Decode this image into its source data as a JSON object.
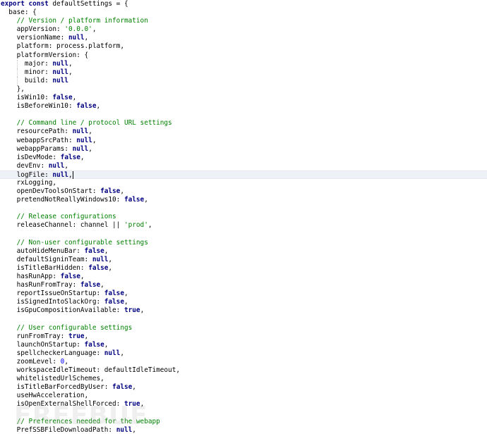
{
  "code_lines": [
    [
      {
        "t": "export const ",
        "k": "kw"
      },
      {
        "t": "defaultSettings = {",
        "k": "plain"
      }
    ],
    [
      {
        "t": "  base: {",
        "k": "plain"
      }
    ],
    [
      {
        "t": "    // Version / platform information",
        "k": "comment"
      }
    ],
    [
      {
        "t": "    appVersion: ",
        "k": "plain"
      },
      {
        "t": "'0.0.0'",
        "k": "str"
      },
      {
        "t": ",",
        "k": "plain"
      }
    ],
    [
      {
        "t": "    versionName: ",
        "k": "plain"
      },
      {
        "t": "null",
        "k": "null"
      },
      {
        "t": ",",
        "k": "plain"
      }
    ],
    [
      {
        "t": "    platform: process.platform,",
        "k": "plain"
      }
    ],
    [
      {
        "t": "    platformVersion: {",
        "k": "plain"
      }
    ],
    [
      {
        "t": "      major: ",
        "k": "plain"
      },
      {
        "t": "null",
        "k": "null"
      },
      {
        "t": ",",
        "k": "plain"
      }
    ],
    [
      {
        "t": "      minor: ",
        "k": "plain"
      },
      {
        "t": "null",
        "k": "null"
      },
      {
        "t": ",",
        "k": "plain"
      }
    ],
    [
      {
        "t": "      build: ",
        "k": "plain"
      },
      {
        "t": "null",
        "k": "null"
      }
    ],
    [
      {
        "t": "    },",
        "k": "plain"
      }
    ],
    [
      {
        "t": "    isWin10: ",
        "k": "plain"
      },
      {
        "t": "false",
        "k": "bool"
      },
      {
        "t": ",",
        "k": "plain"
      }
    ],
    [
      {
        "t": "    isBeforeWin10: ",
        "k": "plain"
      },
      {
        "t": "false",
        "k": "bool"
      },
      {
        "t": ",",
        "k": "plain"
      }
    ],
    [],
    [
      {
        "t": "    // Command line / protocol URL settings",
        "k": "comment"
      }
    ],
    [
      {
        "t": "    resourcePath: ",
        "k": "plain"
      },
      {
        "t": "null",
        "k": "null"
      },
      {
        "t": ",",
        "k": "plain"
      }
    ],
    [
      {
        "t": "    webappSrcPath: ",
        "k": "plain"
      },
      {
        "t": "null",
        "k": "null"
      },
      {
        "t": ",",
        "k": "plain"
      }
    ],
    [
      {
        "t": "    webappParams: ",
        "k": "plain"
      },
      {
        "t": "null",
        "k": "null"
      },
      {
        "t": ",",
        "k": "plain"
      }
    ],
    [
      {
        "t": "    isDevMode: ",
        "k": "plain"
      },
      {
        "t": "false",
        "k": "bool"
      },
      {
        "t": ",",
        "k": "plain"
      }
    ],
    [
      {
        "t": "    devEnv: ",
        "k": "plain"
      },
      {
        "t": "null",
        "k": "null"
      },
      {
        "t": ",",
        "k": "plain"
      }
    ],
    [
      {
        "t": "    logFile: ",
        "k": "plain"
      },
      {
        "t": "null",
        "k": "null"
      },
      {
        "t": ",",
        "k": "plain"
      }
    ],
    [
      {
        "t": "    rxLogging,",
        "k": "plain"
      }
    ],
    [
      {
        "t": "    openDevToolsOnStart: ",
        "k": "plain"
      },
      {
        "t": "false",
        "k": "bool"
      },
      {
        "t": ",",
        "k": "plain"
      }
    ],
    [
      {
        "t": "    pretendNotReallyWindows10: ",
        "k": "plain"
      },
      {
        "t": "false",
        "k": "bool"
      },
      {
        "t": ",",
        "k": "plain"
      }
    ],
    [],
    [
      {
        "t": "    // Release configurations",
        "k": "comment"
      }
    ],
    [
      {
        "t": "    releaseChannel: channel || ",
        "k": "plain"
      },
      {
        "t": "'prod'",
        "k": "str"
      },
      {
        "t": ",",
        "k": "plain"
      }
    ],
    [],
    [
      {
        "t": "    // Non-user configurable settings",
        "k": "comment"
      }
    ],
    [
      {
        "t": "    autoHideMenuBar: ",
        "k": "plain"
      },
      {
        "t": "false",
        "k": "bool"
      },
      {
        "t": ",",
        "k": "plain"
      }
    ],
    [
      {
        "t": "    defaultSigninTeam: ",
        "k": "plain"
      },
      {
        "t": "null",
        "k": "null"
      },
      {
        "t": ",",
        "k": "plain"
      }
    ],
    [
      {
        "t": "    isTitleBarHidden: ",
        "k": "plain"
      },
      {
        "t": "false",
        "k": "bool"
      },
      {
        "t": ",",
        "k": "plain"
      }
    ],
    [
      {
        "t": "    hasRunApp: ",
        "k": "plain"
      },
      {
        "t": "false",
        "k": "bool"
      },
      {
        "t": ",",
        "k": "plain"
      }
    ],
    [
      {
        "t": "    hasRunFromTray: ",
        "k": "plain"
      },
      {
        "t": "false",
        "k": "bool"
      },
      {
        "t": ",",
        "k": "plain"
      }
    ],
    [
      {
        "t": "    reportIssueOnStartup: ",
        "k": "plain"
      },
      {
        "t": "false",
        "k": "bool"
      },
      {
        "t": ",",
        "k": "plain"
      }
    ],
    [
      {
        "t": "    isSignedIntoSlackOrg: ",
        "k": "plain"
      },
      {
        "t": "false",
        "k": "bool"
      },
      {
        "t": ",",
        "k": "plain"
      }
    ],
    [
      {
        "t": "    isGpuCompositionAvailable: ",
        "k": "plain"
      },
      {
        "t": "true",
        "k": "bool"
      },
      {
        "t": ",",
        "k": "plain"
      }
    ],
    [],
    [
      {
        "t": "    // User configurable settings",
        "k": "comment"
      }
    ],
    [
      {
        "t": "    runFromTray: ",
        "k": "plain"
      },
      {
        "t": "true",
        "k": "bool"
      },
      {
        "t": ",",
        "k": "plain"
      }
    ],
    [
      {
        "t": "    launchOnStartup: ",
        "k": "plain"
      },
      {
        "t": "false",
        "k": "bool"
      },
      {
        "t": ",",
        "k": "plain"
      }
    ],
    [
      {
        "t": "    spellcheckerLanguage: ",
        "k": "plain"
      },
      {
        "t": "null",
        "k": "null"
      },
      {
        "t": ",",
        "k": "plain"
      }
    ],
    [
      {
        "t": "    zoomLevel: ",
        "k": "plain"
      },
      {
        "t": "0",
        "k": "num"
      },
      {
        "t": ",",
        "k": "plain"
      }
    ],
    [
      {
        "t": "    workspaceIdleTimeout: defaultIdleTimeout,",
        "k": "plain"
      }
    ],
    [
      {
        "t": "    whitelistedUrlSchemes,",
        "k": "plain"
      }
    ],
    [
      {
        "t": "    isTitleBarForcedByUser: ",
        "k": "plain"
      },
      {
        "t": "false",
        "k": "bool"
      },
      {
        "t": ",",
        "k": "plain"
      }
    ],
    [
      {
        "t": "    useHwAcceleration,",
        "k": "plain"
      }
    ],
    [
      {
        "t": "    isOpenExternalShellForced: ",
        "k": "plain"
      },
      {
        "t": "true",
        "k": "bool"
      },
      {
        "t": ",",
        "k": "plain"
      }
    ],
    [],
    [
      {
        "t": "    // Preferences needed for the webapp",
        "k": "comment"
      }
    ],
    [
      {
        "t": "    PrefSSBFileDownloadPath: ",
        "k": "plain"
      },
      {
        "t": "null",
        "k": "null"
      },
      {
        "t": ",",
        "k": "plain"
      }
    ]
  ],
  "current_line_index": 20,
  "watermark_text": "FREEBUF"
}
